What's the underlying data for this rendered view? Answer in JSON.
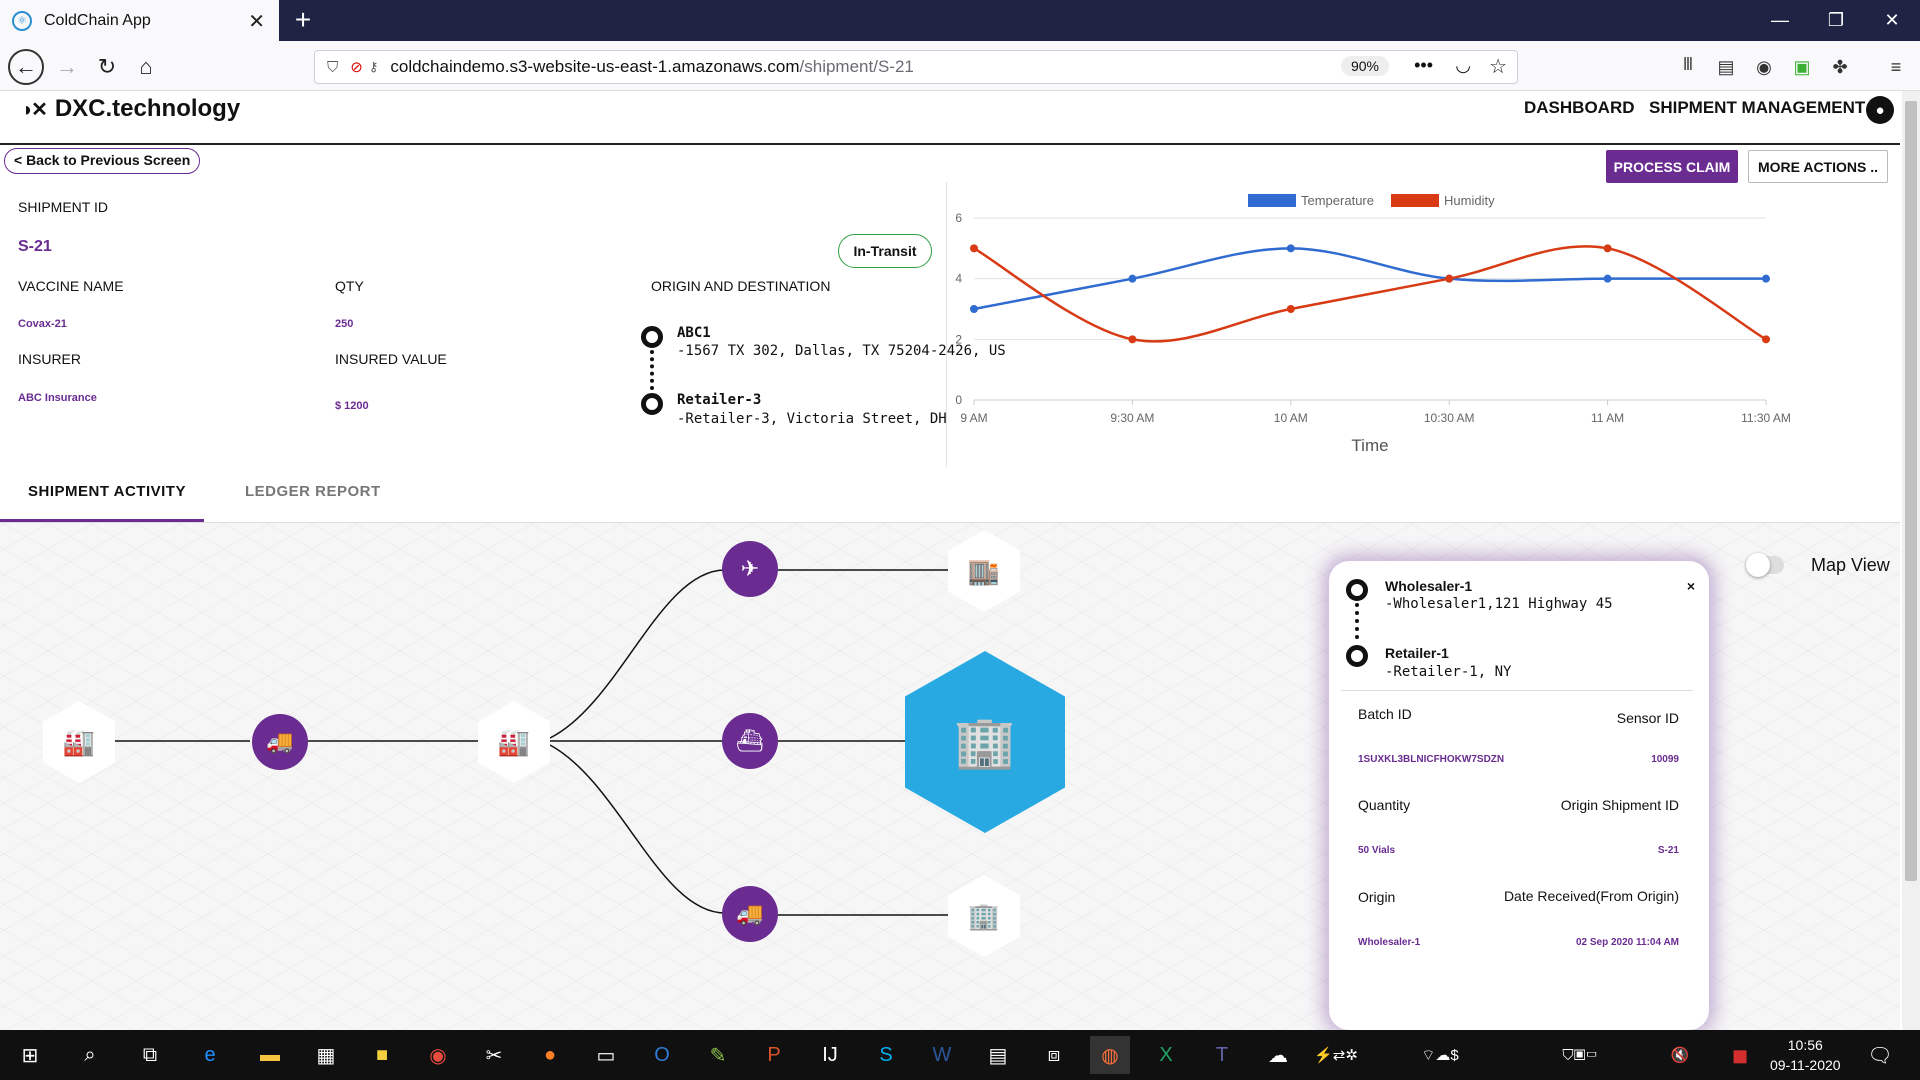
{
  "browser": {
    "tab_title": "ColdChain App",
    "tab_close": "✕",
    "new_tab": "+",
    "url_host": "coldchaindemo.s3-website-us-east-1.amazonaws.com",
    "url_path": "/shipment/S-21",
    "zoom": "90%"
  },
  "app": {
    "brand": "DXC.technology",
    "nav": [
      "DASHBOARD",
      "SHIPMENT MANAGEMENT"
    ],
    "back_label": "< Back to Previous Screen",
    "process_claim": "PROCESS CLAIM",
    "more_actions": "MORE ACTIONS .."
  },
  "shipment": {
    "id_label": "SHIPMENT ID",
    "id": "S-21",
    "status": "In-Transit",
    "vaccine_label": "VACCINE NAME",
    "vaccine": "Covax-21",
    "qty_label": "QTY",
    "qty": "250",
    "insurer_label": "INSURER",
    "insurer": "ABC Insurance",
    "insured_value_label": "INSURED VALUE",
    "insured_value": "$ 1200",
    "route_label": "ORIGIN AND DESTINATION",
    "origin_name": "ABC1",
    "origin_addr": "-1567 TX 302, Dallas, TX 75204-2426, US",
    "dest_name": "Retailer-3",
    "dest_addr": "-Retailer-3, Victoria Street, DH"
  },
  "chart_data": {
    "type": "line",
    "categories": [
      "9 AM",
      "9:30 AM",
      "10 AM",
      "10:30 AM",
      "11 AM",
      "11:30 AM"
    ],
    "series": [
      {
        "name": "Temperature",
        "values": [
          3,
          4,
          5,
          4,
          4,
          4
        ],
        "color": "#2f6bd0"
      },
      {
        "name": "Humidity",
        "values": [
          5,
          2,
          3,
          4,
          5,
          2
        ],
        "color": "#d83a14"
      }
    ],
    "yticks": [
      "0",
      "2",
      "4",
      "6"
    ],
    "ylim": [
      0,
      6
    ],
    "xlabel": "Time",
    "ylabel": "",
    "grid": true,
    "legend": "top"
  },
  "tabs": [
    "SHIPMENT ACTIVITY",
    "LEDGER REPORT"
  ],
  "activity": {
    "map_view_label": "Map View",
    "card": {
      "close": "×",
      "from_name": "Wholesaler-1",
      "from_addr": "-Wholesaler1,121 Highway 45",
      "to_name": "Retailer-1",
      "to_addr": "-Retailer-1, NY",
      "batch_label": "Batch ID",
      "batch": "1SUXKL3BLNICFHOKW7SDZN",
      "sensor_label": "Sensor ID",
      "sensor": "10099",
      "quantity_label": "Quantity",
      "quantity": "50 Vials",
      "origin_shipment_label": "Origin Shipment ID",
      "origin_shipment": "S-21",
      "origin_label": "Origin",
      "origin": "Wholesaler-1",
      "date_label": "Date Received(From Origin)",
      "date": "02 Sep 2020 11:04 AM"
    }
  },
  "taskbar": {
    "time": "10:56",
    "date": "09-11-2020"
  },
  "colors": {
    "accent": "#6a2c91",
    "hex_blue": "#29a9e1",
    "status_green": "#2e9e3e"
  }
}
